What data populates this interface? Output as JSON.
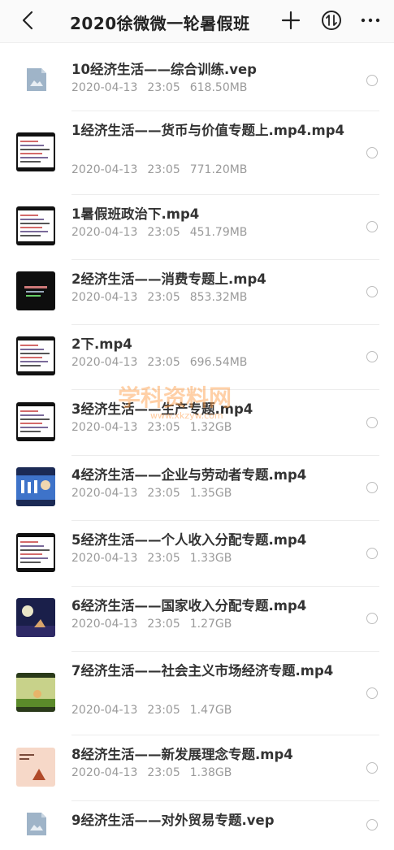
{
  "header": {
    "title": "2020徐微微一轮暑假班"
  },
  "files": [
    {
      "name": "10经济生活——综合训练.vep",
      "date": "2020-04-13",
      "time": "23:05",
      "size": "618.50MB",
      "thumb": "vep"
    },
    {
      "name": "1经济生活——货币与价值专题上.mp4.mp4",
      "date": "2020-04-13",
      "time": "23:05",
      "size": "771.20MB",
      "thumb": "doc"
    },
    {
      "name": "1暑假班政治下.mp4",
      "date": "2020-04-13",
      "time": "23:05",
      "size": "451.79MB",
      "thumb": "doc"
    },
    {
      "name": "2经济生活——消费专题上.mp4",
      "date": "2020-04-13",
      "time": "23:05",
      "size": "853.32MB",
      "thumb": "dark"
    },
    {
      "name": "2下.mp4",
      "date": "2020-04-13",
      "time": "23:05",
      "size": "696.54MB",
      "thumb": "doc"
    },
    {
      "name": "3经济生活——生产专题.mp4",
      "date": "2020-04-13",
      "time": "23:05",
      "size": "1.32GB",
      "thumb": "doc"
    },
    {
      "name": "4经济生活——企业与劳动者专题.mp4",
      "date": "2020-04-13",
      "time": "23:05",
      "size": "1.35GB",
      "thumb": "blue"
    },
    {
      "name": "5经济生活——个人收入分配专题.mp4",
      "date": "2020-04-13",
      "time": "23:05",
      "size": "1.33GB",
      "thumb": "doc"
    },
    {
      "name": "6经济生活——国家收入分配专题.mp4",
      "date": "2020-04-13",
      "time": "23:05",
      "size": "1.27GB",
      "thumb": "night"
    },
    {
      "name": "7经济生活——社会主义市场经济专题.mp4",
      "date": "2020-04-13",
      "time": "23:05",
      "size": "1.47GB",
      "thumb": "green"
    },
    {
      "name": "8经济生活——新发展理念专题.mp4",
      "date": "2020-04-13",
      "time": "23:05",
      "size": "1.38GB",
      "thumb": "peach"
    },
    {
      "name": "9经济生活——对外贸易专题.vep",
      "date": "",
      "time": "",
      "size": "",
      "thumb": "vep"
    }
  ],
  "watermark": {
    "text": "学科资料网",
    "url": "www.xkzyw.com"
  }
}
